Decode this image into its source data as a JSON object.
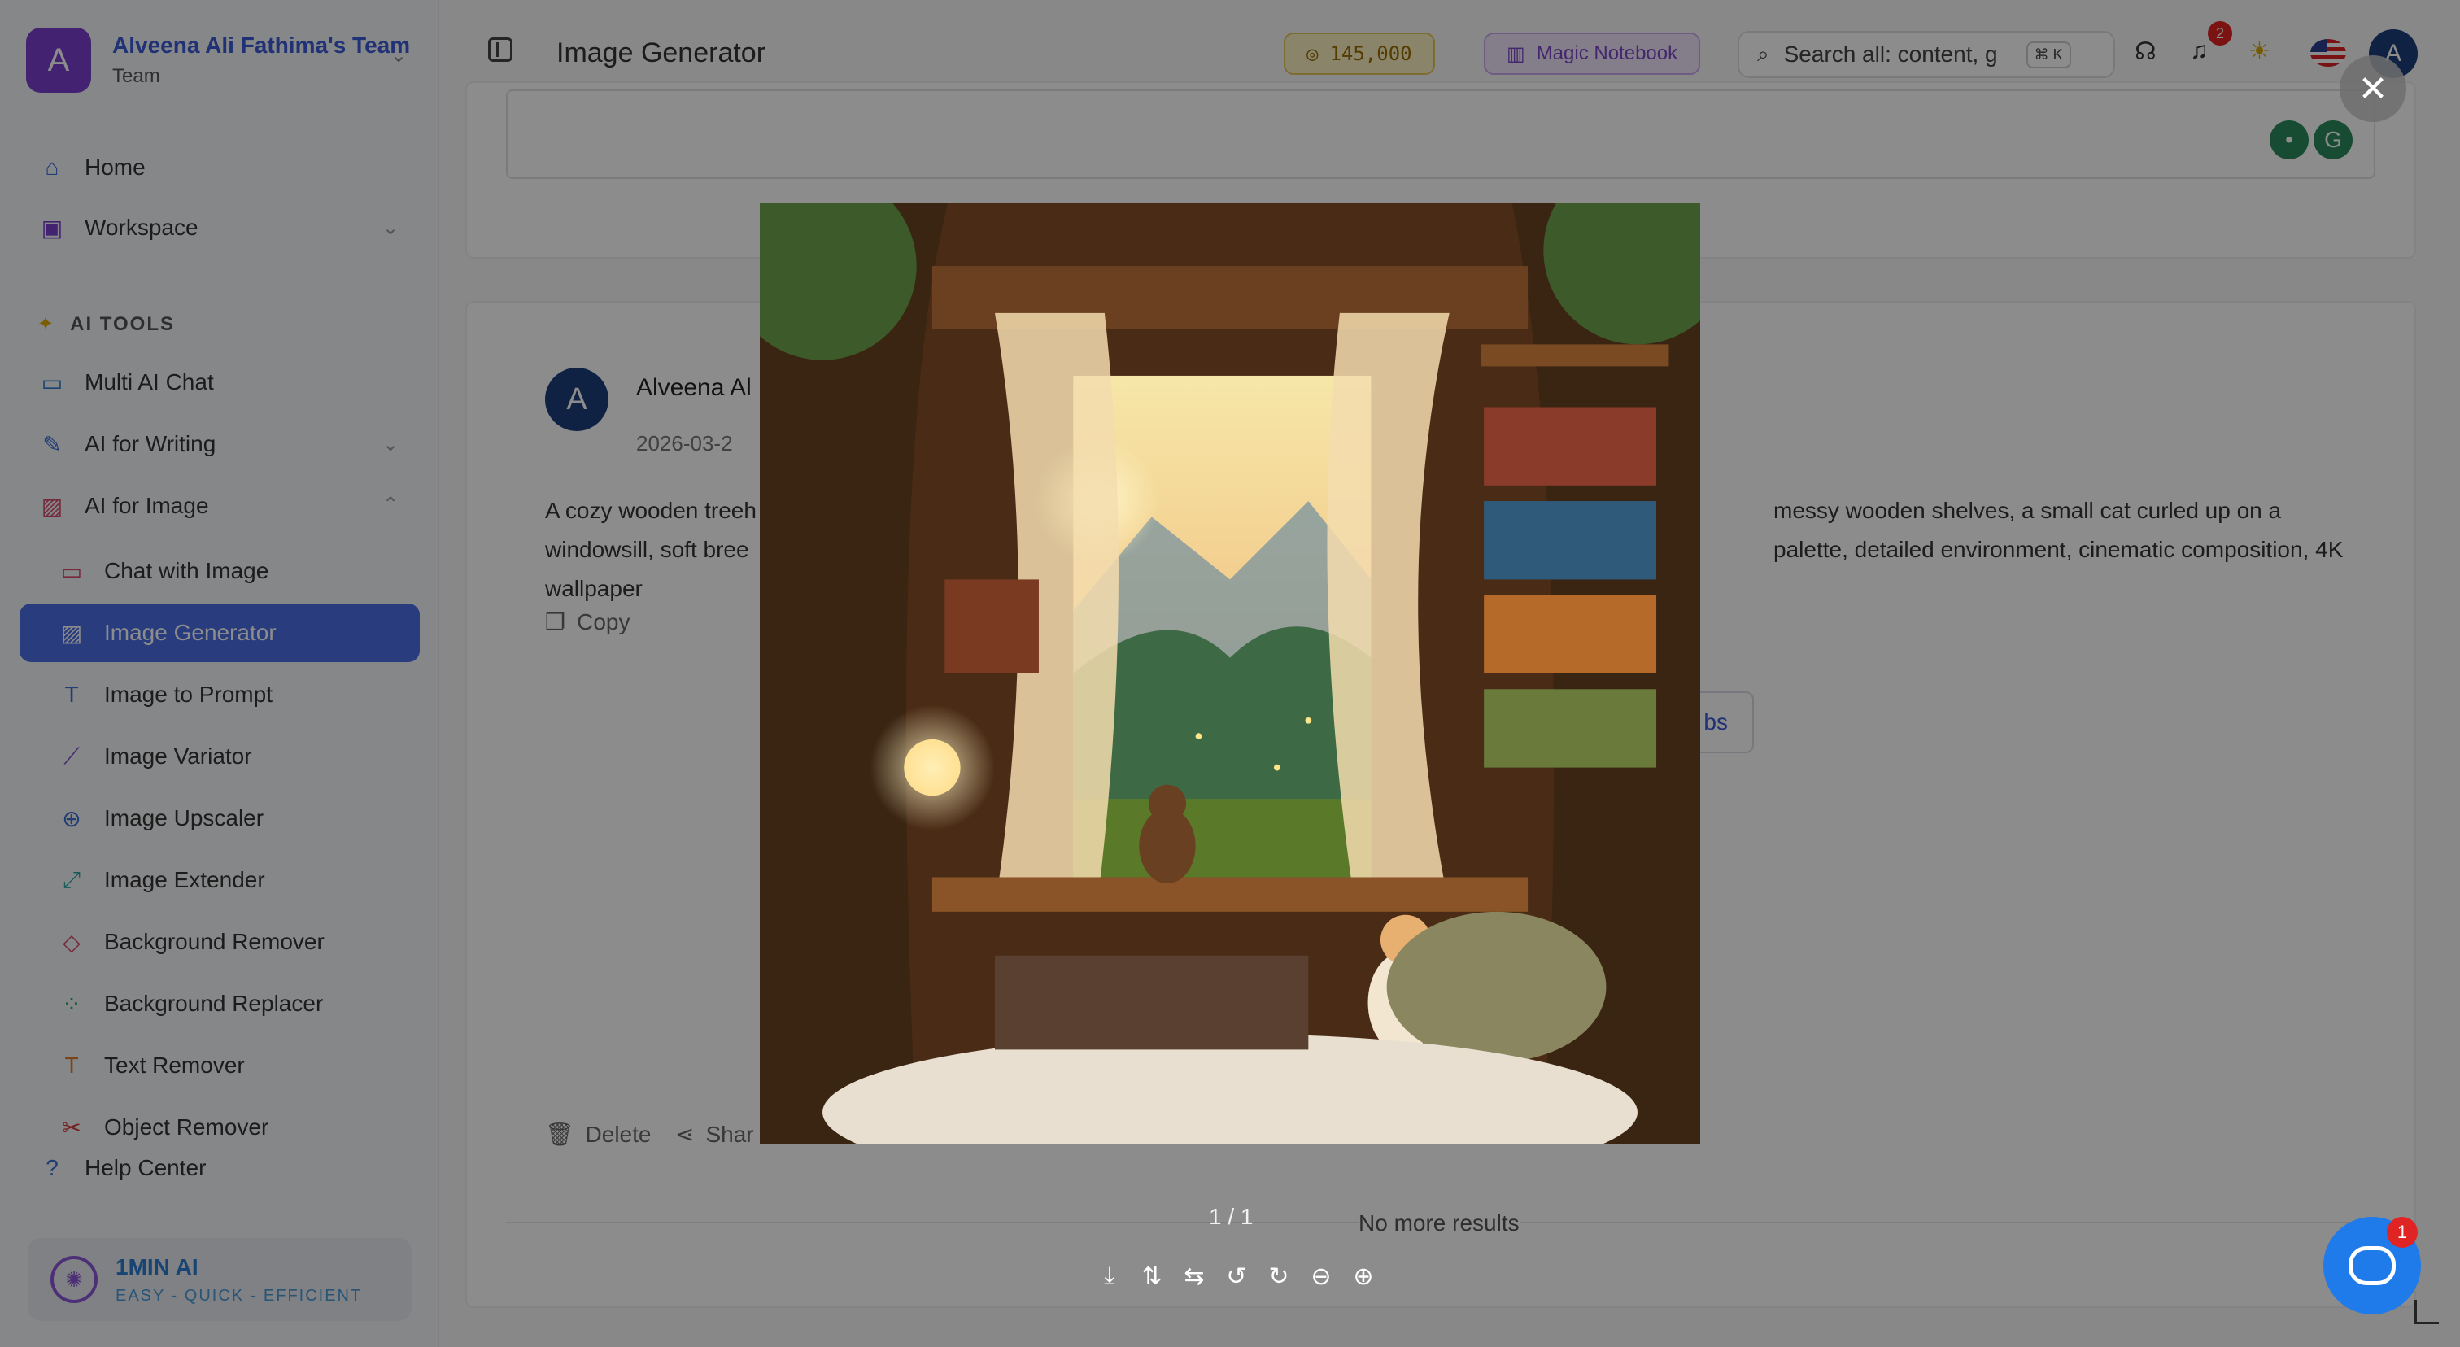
{
  "team": {
    "avatar_letter": "A",
    "name": "Alveena Ali Fathima's Team",
    "role": "Team"
  },
  "sidebar": {
    "home": "Home",
    "workspace": "Workspace",
    "section_label": "AI TOOLS",
    "multi_ai_chat": "Multi AI Chat",
    "ai_for_writing": "AI for Writing",
    "ai_for_image": "AI for Image",
    "sub_items": [
      "Chat with Image",
      "Image Generator",
      "Image to Prompt",
      "Image Variator",
      "Image Upscaler",
      "Image Extender",
      "Background Remover",
      "Background Replacer",
      "Text Remover",
      "Object Remover"
    ],
    "help_center": "Help Center"
  },
  "brand": {
    "name": "1MIN AI",
    "tagline": "EASY - QUICK - EFFICIENT"
  },
  "header": {
    "title": "Image Generator",
    "credits": "145,000",
    "magic_notebook": "Magic Notebook",
    "search_placeholder": "Search all: content, g",
    "search_shortcut": "⌘ K",
    "notification_count": "2",
    "user_avatar_letter": "A"
  },
  "message": {
    "avatar_letter": "A",
    "author": "Alveena Al",
    "date": "2026-03-2",
    "text_left_1": "A cozy wooden treeh",
    "text_right_1": "messy wooden shelves, a small cat curled up on a",
    "text_left_2": "windowsill, soft bree",
    "text_right_2": "palette, detailed environment, cinematic composition, 4K",
    "text_line_3": "wallpaper",
    "copy_label": "Copy",
    "jobs_label": "bs",
    "delete_label": "Delete",
    "share_label": "Shar"
  },
  "list_footer": {
    "no_more": "No more results"
  },
  "viewer": {
    "counter": "1 / 1",
    "close_icon": "close-icon",
    "tools": [
      "download-icon",
      "flip-vertical-icon",
      "flip-horizontal-icon",
      "rotate-left-icon",
      "rotate-right-icon",
      "zoom-out-icon",
      "zoom-in-icon"
    ]
  },
  "chat_widget": {
    "badge": "1"
  }
}
